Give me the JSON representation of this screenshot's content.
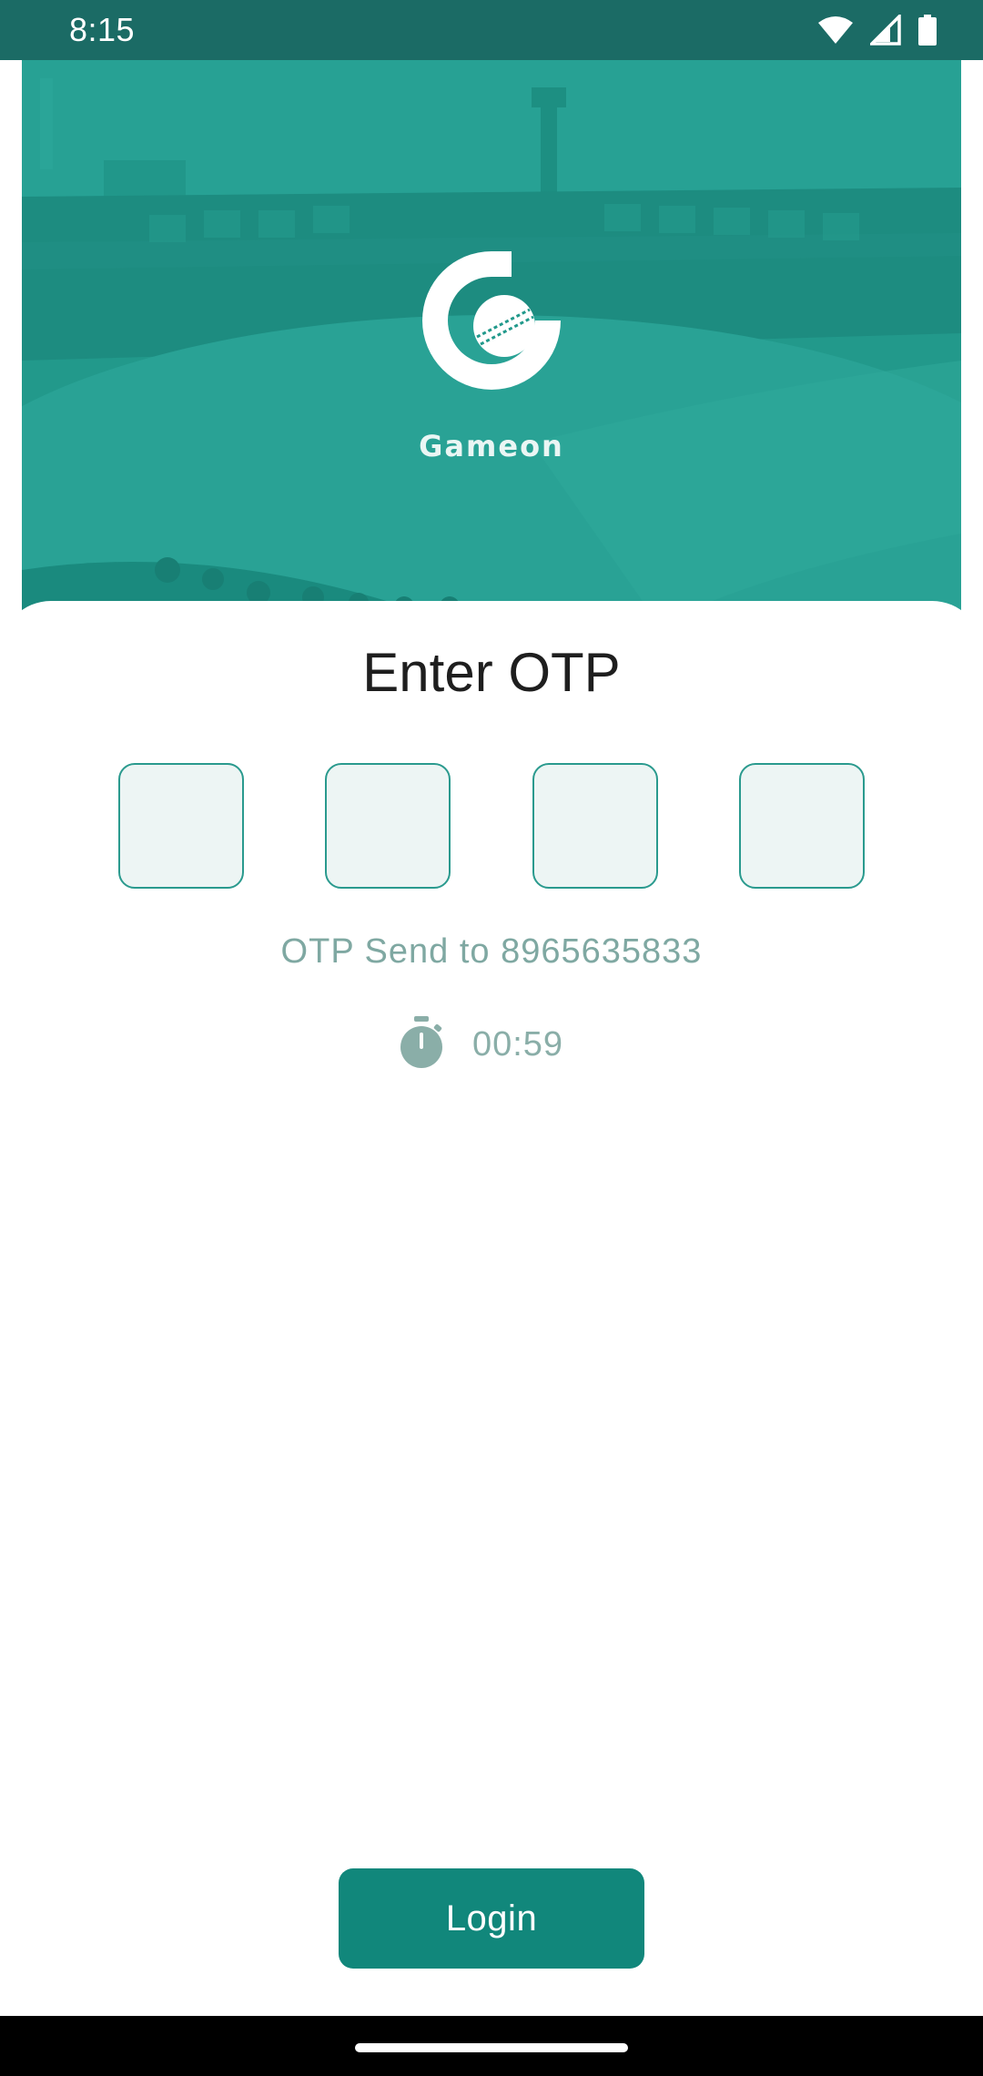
{
  "status_bar": {
    "time": "8:15",
    "icons": [
      "wifi-icon",
      "cell-signal-icon",
      "battery-icon"
    ]
  },
  "brand": {
    "name": "Gameon",
    "logo_icon": "gameon-logo-icon",
    "hero_background": "stadium"
  },
  "otp": {
    "title": "Enter OTP",
    "boxes": [
      "",
      "",
      "",
      ""
    ],
    "sent_to_label": "OTP Send to 8965635833",
    "timer": "00:59",
    "timer_icon": "stopwatch-icon"
  },
  "actions": {
    "login_label": "Login"
  },
  "colors": {
    "primary": "#11877b",
    "hero": "#21998b",
    "status_bar": "#1b6b65",
    "otp_border": "#2a9a8e",
    "otp_fill": "#edf5f4",
    "muted_text": "#7fa8a2"
  }
}
